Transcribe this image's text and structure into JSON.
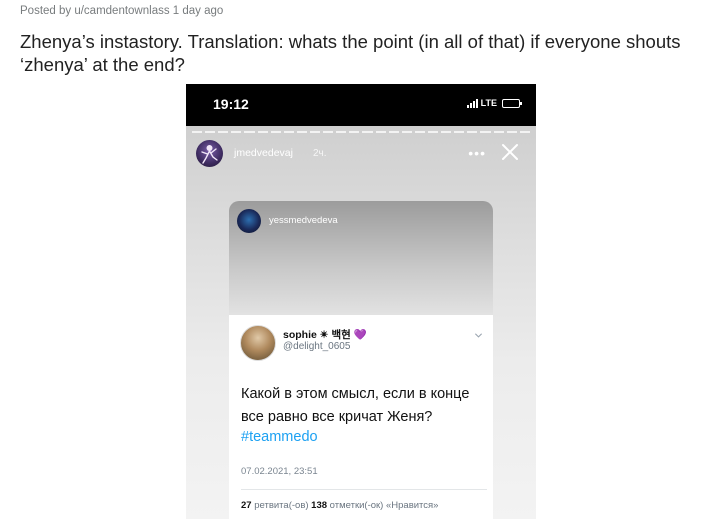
{
  "post": {
    "meta": "Posted by u/camdentownlass 1 day ago",
    "title": "Zhenya’s instastory. Translation: whats the point (in all of that) if everyone shouts ‘zhenya’ at the end?"
  },
  "phone": {
    "time": "19:12",
    "network": "LTE"
  },
  "story": {
    "username": "jmedvedevaj",
    "time_ago": "2ч.",
    "more_glyph": "•••",
    "shared_username": "yessmedvedeva"
  },
  "tweet": {
    "display_name": "sophie ✴ 백현 💜",
    "handle": "@delight_0605",
    "text": "Какой в этом смысл, если в конце все равно все кричат Женя?",
    "hashtag": "#teammedo",
    "date": "07.02.2021, 23:51",
    "retweets_count": "27",
    "retweets_label": "ретвита(-ов)",
    "likes_count": "138",
    "likes_label": "отметки(-ок) «Нравится»"
  },
  "colors": {
    "hashtag": "#1da1f2",
    "meta_text": "#787c7e"
  },
  "icons": {
    "close": "close-icon",
    "more": "more-icon",
    "chevron": "chevron-down-icon",
    "battery": "battery-icon",
    "signal": "signal-icon"
  }
}
